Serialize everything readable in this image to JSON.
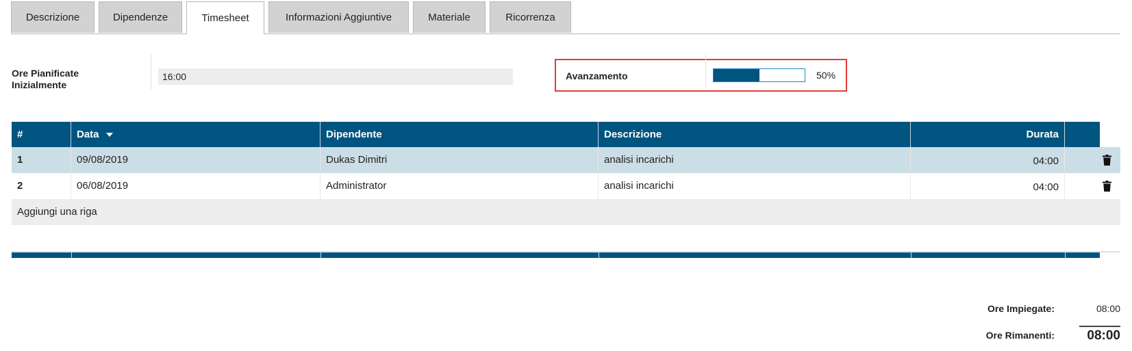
{
  "tabs": [
    {
      "label": "Descrizione"
    },
    {
      "label": "Dipendenze"
    },
    {
      "label": "Timesheet"
    },
    {
      "label": "Informazioni Aggiuntive"
    },
    {
      "label": "Materiale"
    },
    {
      "label": "Ricorrenza"
    }
  ],
  "active_tab": "Timesheet",
  "fields": {
    "ore_label": "Ore Pianificate Inizialmente",
    "ore_value": "16:00",
    "avanzamento_label": "Avanzamento",
    "avanzamento_fraction": 0.5,
    "avanzamento_text": "50%"
  },
  "table": {
    "headers": {
      "num": "#",
      "data": "Data",
      "dipendente": "Dipendente",
      "descrizione": "Descrizione",
      "durata": "Durata"
    },
    "rows": [
      {
        "num": "1",
        "data": "09/08/2019",
        "dipendente": "Dukas Dimitri",
        "descrizione": "analisi incarichi",
        "durata": "04:00"
      },
      {
        "num": "2",
        "data": "06/08/2019",
        "dipendente": "Administrator",
        "descrizione": "analisi incarichi",
        "durata": "04:00"
      }
    ],
    "add_row": "Aggiungi una riga"
  },
  "totals": {
    "impiegate_label": "Ore Impiegate:",
    "impiegate_value": "08:00",
    "rimanenti_label": "Ore Rimanenti:",
    "rimanenti_value": "08:00"
  },
  "colors": {
    "header": "#005580",
    "selected_row": "#cbdde5",
    "highlight_border": "#e23b3b"
  },
  "icons": {
    "delete": "trash-icon",
    "sort": "sort-desc-icon"
  }
}
